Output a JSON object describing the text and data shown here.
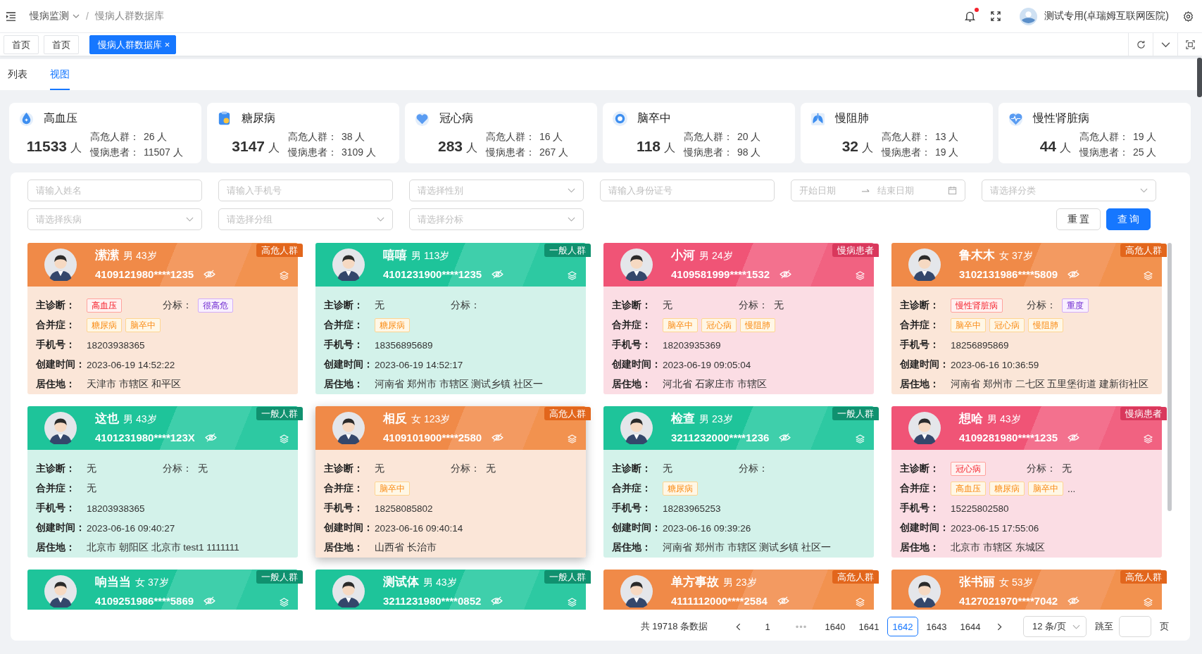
{
  "topbar": {
    "breadcrumb": [
      {
        "label": "慢病监测",
        "dropdown": true
      },
      {
        "label": "慢病人群数据库",
        "dropdown": false
      }
    ],
    "breadcrumb_separator": "/",
    "has_unread": true,
    "user_name": "测试专用(卓瑞姆互联网医院)"
  },
  "page_tabs": [
    {
      "label": "首页",
      "selected": false,
      "closable": false
    },
    {
      "label": "首页",
      "selected": false,
      "closable": false
    },
    {
      "label": "慢病人群数据库",
      "selected": true,
      "closable": true
    }
  ],
  "view_tabs": [
    {
      "label": "列表",
      "selected": false
    },
    {
      "label": "视图",
      "selected": true
    }
  ],
  "stats": [
    {
      "title": "高血压",
      "total": "11533",
      "unit": "人",
      "rows": [
        {
          "label": "高危人群：",
          "value": "26 人"
        },
        {
          "label": "慢病患者：",
          "value": "11507 人"
        }
      ]
    },
    {
      "title": "糖尿病",
      "total": "3147",
      "unit": "人",
      "rows": [
        {
          "label": "高危人群：",
          "value": "38 人"
        },
        {
          "label": "慢病患者：",
          "value": "3109 人"
        }
      ]
    },
    {
      "title": "冠心病",
      "total": "283",
      "unit": "人",
      "rows": [
        {
          "label": "高危人群：",
          "value": "16 人"
        },
        {
          "label": "慢病患者：",
          "value": "267 人"
        }
      ]
    },
    {
      "title": "脑卒中",
      "total": "118",
      "unit": "人",
      "rows": [
        {
          "label": "高危人群：",
          "value": "20 人"
        },
        {
          "label": "慢病患者：",
          "value": "98 人"
        }
      ]
    },
    {
      "title": "慢阻肺",
      "total": "32",
      "unit": "人",
      "rows": [
        {
          "label": "高危人群：",
          "value": "13 人"
        },
        {
          "label": "慢病患者：",
          "value": "19 人"
        }
      ]
    },
    {
      "title": "慢性肾脏病",
      "total": "44",
      "unit": "人",
      "rows": [
        {
          "label": "高危人群：",
          "value": "19 人"
        },
        {
          "label": "慢病患者：",
          "value": "25 人"
        }
      ]
    }
  ],
  "filters": [
    {
      "kind": "input",
      "placeholder": "请输入姓名"
    },
    {
      "kind": "input",
      "placeholder": "请输入手机号"
    },
    {
      "kind": "select",
      "placeholder": "请选择性别"
    },
    {
      "kind": "input",
      "placeholder": "请输入身份证号"
    },
    {
      "kind": "daterange",
      "start_placeholder": "开始日期",
      "end_placeholder": "结束日期"
    },
    {
      "kind": "select",
      "placeholder": "请选择分类"
    },
    {
      "kind": "select",
      "placeholder": "请选择疾病"
    },
    {
      "kind": "select",
      "placeholder": "请选择分组"
    },
    {
      "kind": "select",
      "placeholder": "请选择分标"
    }
  ],
  "buttons": [
    {
      "label": "重 置",
      "kind": "default"
    },
    {
      "label": "查 询",
      "kind": "primary"
    }
  ],
  "cards": [
    {
      "name": "潆潆",
      "gender": "男",
      "age": "43岁",
      "id_number": "4109121980****1235",
      "group": "高危人群",
      "kind": "high_risk",
      "highlighted": false,
      "diagnosis": {
        "label": "主诊断：",
        "tags": [
          "高血压"
        ]
      },
      "grade": {
        "label": "分标：",
        "tags": [
          "很高危"
        ]
      },
      "complications": {
        "label": "合并症：",
        "tags": [
          "糖尿病",
          "脑卒中"
        ]
      },
      "phone": {
        "label": "手机号：",
        "value": "18203938365"
      },
      "created": {
        "label": "创建时间：",
        "value": "2023-06-19 14:52:22"
      },
      "address": {
        "label": "居住地：",
        "value": "天津市 市辖区 和平区"
      }
    },
    {
      "name": "嘻嘻",
      "gender": "男",
      "age": "113岁",
      "id_number": "4101231900****1235",
      "group": "一般人群",
      "kind": "general",
      "highlighted": false,
      "diagnosis": {
        "label": "主诊断：",
        "value": "无"
      },
      "grade": {
        "label": "分标："
      },
      "complications": {
        "label": "合并症：",
        "tags": [
          "糖尿病"
        ]
      },
      "phone": {
        "label": "手机号：",
        "value": "18356895689"
      },
      "created": {
        "label": "创建时间：",
        "value": "2023-06-19 14:52:17"
      },
      "address": {
        "label": "居住地：",
        "value": "河南省 郑州市 市辖区 测试乡镇 社区一"
      }
    },
    {
      "name": "小河",
      "gender": "男",
      "age": "24岁",
      "id_number": "4109581999****1532",
      "group": "慢病患者",
      "kind": "chronic",
      "highlighted": false,
      "diagnosis": {
        "label": "主诊断：",
        "value": "无"
      },
      "grade": {
        "label": "分标：",
        "value": "无"
      },
      "complications": {
        "label": "合并症：",
        "tags": [
          "脑卒中",
          "冠心病",
          "慢阻肺"
        ]
      },
      "phone": {
        "label": "手机号：",
        "value": "18203935369"
      },
      "created": {
        "label": "创建时间：",
        "value": "2023-06-19 09:05:04"
      },
      "address": {
        "label": "居住地：",
        "value": "河北省 石家庄市 市辖区"
      }
    },
    {
      "name": "鲁木木",
      "gender": "女",
      "age": "37岁",
      "id_number": "3102131986****5809",
      "group": "高危人群",
      "kind": "high_risk",
      "highlighted": false,
      "diagnosis": {
        "label": "主诊断：",
        "tags": [
          "慢性肾脏病"
        ]
      },
      "grade": {
        "label": "分标：",
        "tags": [
          "重度"
        ]
      },
      "complications": {
        "label": "合并症：",
        "tags": [
          "脑卒中",
          "冠心病",
          "慢阻肺"
        ]
      },
      "phone": {
        "label": "手机号：",
        "value": "18256895869"
      },
      "created": {
        "label": "创建时间：",
        "value": "2023-06-16 10:36:59"
      },
      "address": {
        "label": "居住地：",
        "value": "河南省 郑州市 二七区 五里堡街道 建新街社区"
      }
    },
    {
      "name": "这也",
      "gender": "男",
      "age": "43岁",
      "id_number": "4101231980****123X",
      "group": "一般人群",
      "kind": "general",
      "highlighted": false,
      "diagnosis": {
        "label": "主诊断：",
        "value": "无"
      },
      "grade": {
        "label": "分标：",
        "value": "无"
      },
      "complications": {
        "label": "合并症：",
        "value": "无"
      },
      "phone": {
        "label": "手机号：",
        "value": "18203938365"
      },
      "created": {
        "label": "创建时间：",
        "value": "2023-06-16 09:40:27"
      },
      "address": {
        "label": "居住地：",
        "value": "北京市 朝阳区 北京市 test1 1111111"
      }
    },
    {
      "name": "相反",
      "gender": "女",
      "age": "123岁",
      "id_number": "4109101900****2580",
      "group": "高危人群",
      "kind": "high_risk",
      "highlighted": true,
      "diagnosis": {
        "label": "主诊断：",
        "value": "无"
      },
      "grade": {
        "label": "分标：",
        "value": "无"
      },
      "complications": {
        "label": "合并症：",
        "tags": [
          "脑卒中"
        ]
      },
      "phone": {
        "label": "手机号：",
        "value": "18258085802"
      },
      "created": {
        "label": "创建时间：",
        "value": "2023-06-16 09:40:14"
      },
      "address": {
        "label": "居住地：",
        "value": "山西省 长治市"
      }
    },
    {
      "name": "检查",
      "gender": "男",
      "age": "23岁",
      "id_number": "3211232000****1236",
      "group": "一般人群",
      "kind": "general",
      "highlighted": false,
      "diagnosis": {
        "label": "主诊断：",
        "value": "无"
      },
      "grade": {
        "label": "分标："
      },
      "complications": {
        "label": "合并症：",
        "tags": [
          "糖尿病"
        ]
      },
      "phone": {
        "label": "手机号：",
        "value": "18283965253"
      },
      "created": {
        "label": "创建时间：",
        "value": "2023-06-16 09:39:26"
      },
      "address": {
        "label": "居住地：",
        "value": "河南省 郑州市 市辖区 测试乡镇 社区一"
      }
    },
    {
      "name": "想哈",
      "gender": "男",
      "age": "43岁",
      "id_number": "4109281980****1235",
      "group": "慢病患者",
      "kind": "chronic",
      "highlighted": false,
      "diagnosis": {
        "label": "主诊断：",
        "tags": [
          "冠心病"
        ]
      },
      "grade": {
        "label": "分标：",
        "value": "无"
      },
      "complications": {
        "label": "合并症：",
        "tags": [
          "高血压",
          "糖尿病",
          "脑卒中"
        ],
        "more": "..."
      },
      "phone": {
        "label": "手机号：",
        "value": "15225802580"
      },
      "created": {
        "label": "创建时间：",
        "value": "2023-06-15 17:55:06"
      },
      "address": {
        "label": "居住地：",
        "value": "北京市 市辖区 东城区"
      }
    },
    {
      "name": "响当当",
      "gender": "女",
      "age": "37岁",
      "id_number": "4109251986****5869",
      "group": "一般人群",
      "kind": "general",
      "highlighted": false
    },
    {
      "name": "测试体",
      "gender": "男",
      "age": "43岁",
      "id_number": "3211231980****0852",
      "group": "一般人群",
      "kind": "general",
      "highlighted": false
    },
    {
      "name": "单方事故",
      "gender": "男",
      "age": "23岁",
      "id_number": "4111112000****2584",
      "group": "高危人群",
      "kind": "high_risk",
      "highlighted": false
    },
    {
      "name": "张书丽",
      "gender": "女",
      "age": "53岁",
      "id_number": "4127021970****7042",
      "group": "高危人群",
      "kind": "high_risk",
      "highlighted": false
    }
  ],
  "pagination": {
    "total_text": "共 19718 条数据",
    "pages": [
      {
        "label": "1",
        "kind": "page",
        "selected": false
      },
      {
        "label": "•••",
        "kind": "ellipsis",
        "selected": false
      },
      {
        "label": "1640",
        "kind": "page",
        "selected": false
      },
      {
        "label": "1641",
        "kind": "page",
        "selected": false
      },
      {
        "label": "1642",
        "kind": "page",
        "selected": true
      },
      {
        "label": "1643",
        "kind": "page",
        "selected": false
      },
      {
        "label": "1644",
        "kind": "page",
        "selected": false
      }
    ],
    "page_size": "12 条/页",
    "jump_label": "跳至",
    "jump_suffix": "页"
  }
}
